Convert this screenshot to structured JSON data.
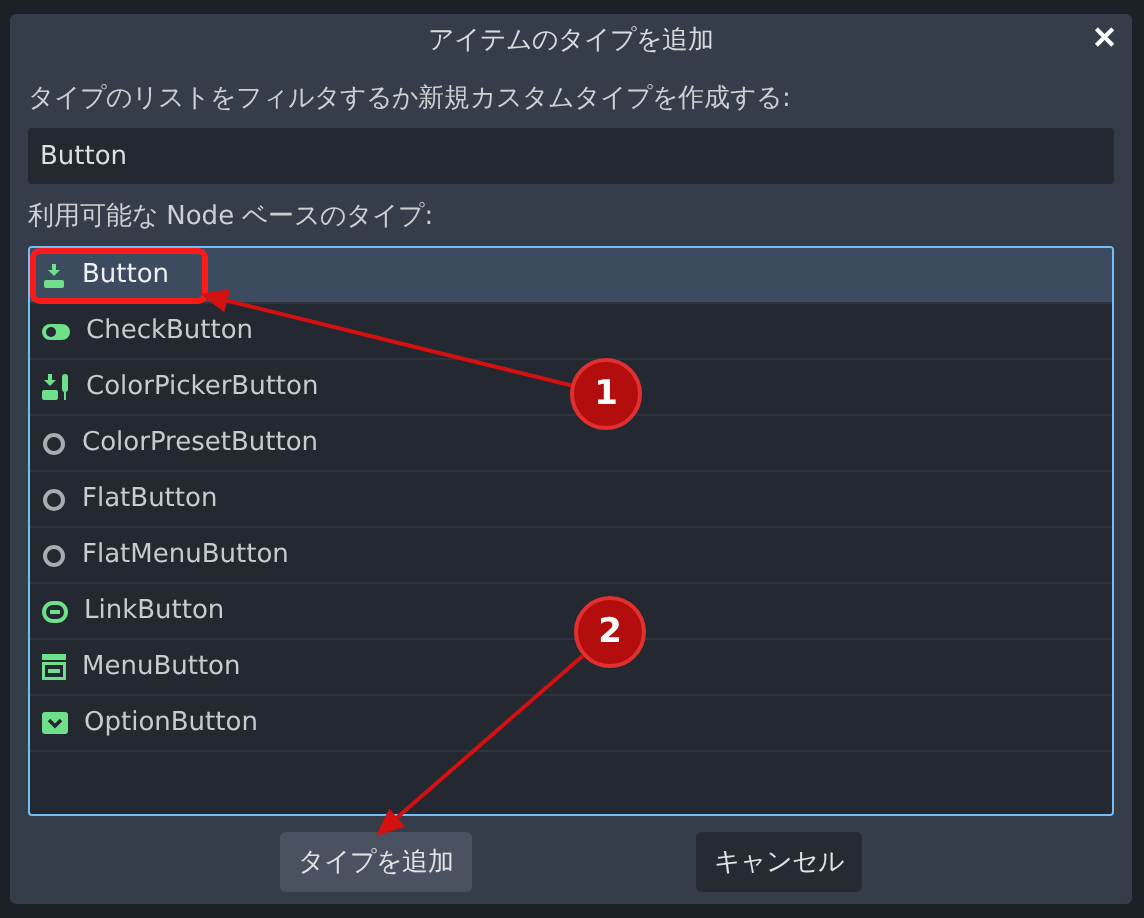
{
  "dialog": {
    "title": "アイテムのタイプを追加",
    "close": "✕",
    "filter_label": "タイプのリストをフィルタするか新規カスタムタイプを作成する:",
    "filter_value": "Button",
    "list_label": "利用可能な Node ベースのタイプ:",
    "items": [
      {
        "label": "Button",
        "kind": "button",
        "selected": true,
        "highlighted": true
      },
      {
        "label": "CheckButton",
        "kind": "check",
        "selected": false,
        "highlighted": false
      },
      {
        "label": "ColorPickerButton",
        "kind": "colorpicker",
        "selected": false,
        "highlighted": false
      },
      {
        "label": "ColorPresetButton",
        "kind": "plain",
        "selected": false,
        "highlighted": false
      },
      {
        "label": "FlatButton",
        "kind": "plain",
        "selected": false,
        "highlighted": false
      },
      {
        "label": "FlatMenuButton",
        "kind": "plain",
        "selected": false,
        "highlighted": false
      },
      {
        "label": "LinkButton",
        "kind": "link",
        "selected": false,
        "highlighted": false
      },
      {
        "label": "MenuButton",
        "kind": "menu",
        "selected": false,
        "highlighted": false
      },
      {
        "label": "OptionButton",
        "kind": "option",
        "selected": false,
        "highlighted": false
      }
    ],
    "buttons": [
      {
        "label": "タイプを追加",
        "kind": "primary"
      },
      {
        "label": "キャンセル",
        "kind": "secondary"
      }
    ]
  },
  "annotations": [
    {
      "label": "1"
    },
    {
      "label": "2"
    }
  ]
}
